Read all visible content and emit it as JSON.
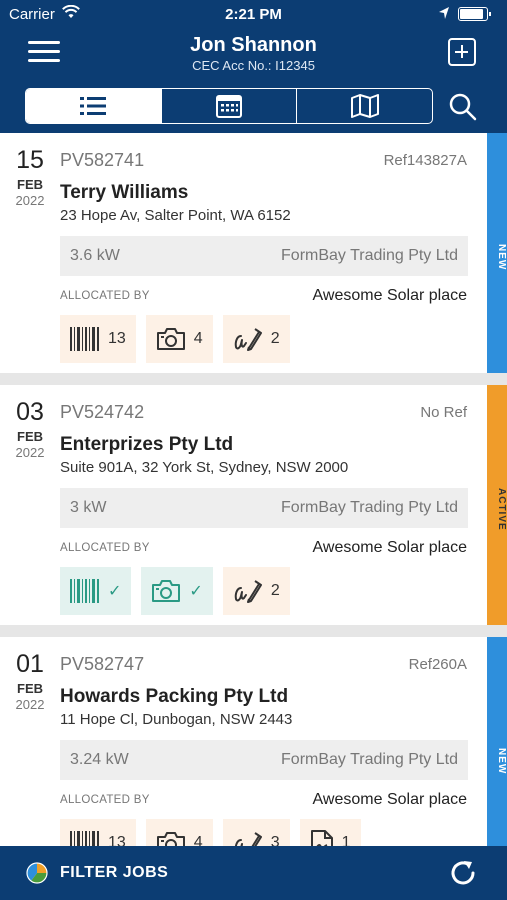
{
  "status_bar": {
    "carrier": "Carrier",
    "time": "2:21 PM"
  },
  "header": {
    "title": "Jon Shannon",
    "subtitle": "CEC Acc No.: I12345"
  },
  "view_tabs": [
    {
      "icon": "list-icon",
      "selected": true
    },
    {
      "icon": "calendar-icon",
      "selected": false
    },
    {
      "icon": "map-icon",
      "selected": false
    }
  ],
  "jobs": [
    {
      "day": "15",
      "month": "FEB",
      "year": "2022",
      "pv": "PV582741",
      "ref": "Ref143827A",
      "name": "Terry Williams",
      "address": "23 Hope Av, Salter Point, WA 6152",
      "kw": "3.6 kW",
      "company": "FormBay Trading Pty Ltd",
      "allocated_label": "ALLOCATED BY",
      "allocated_by": "Awesome Solar place",
      "status": "NEW",
      "badges": {
        "barcode": "13",
        "photo": "4",
        "signature": "2"
      }
    },
    {
      "day": "03",
      "month": "FEB",
      "year": "2022",
      "pv": "PV524742",
      "ref": "No Ref",
      "name": "Enterprizes Pty Ltd",
      "address": "Suite 901A, 32 York St, Sydney, NSW 2000",
      "kw": "3 kW",
      "company": "FormBay Trading Pty Ltd",
      "allocated_label": "ALLOCATED BY",
      "allocated_by": "Awesome Solar place",
      "status": "ACTIVE",
      "badges": {
        "barcode": "✓",
        "photo": "✓",
        "signature": "2"
      }
    },
    {
      "day": "01",
      "month": "FEB",
      "year": "2022",
      "pv": "PV582747",
      "ref": "Ref260A",
      "name": "Howards Packing Pty Ltd",
      "address": "11 Hope Cl, Dunbogan, NSW 2443",
      "kw": "3.24 kW",
      "company": "FormBay Trading Pty Ltd",
      "allocated_label": "ALLOCATED BY",
      "allocated_by": "Awesome Solar place",
      "status": "NEW",
      "badges": {
        "barcode": "13",
        "photo": "4",
        "signature": "3",
        "document": "1"
      }
    }
  ],
  "footer": {
    "filter_label": "FILTER JOBS"
  },
  "colors": {
    "header_bg": "#0c3d73",
    "new_tag": "#2e8fdc",
    "active_tag": "#f09c2a",
    "done_badge": "#2a9a84"
  }
}
